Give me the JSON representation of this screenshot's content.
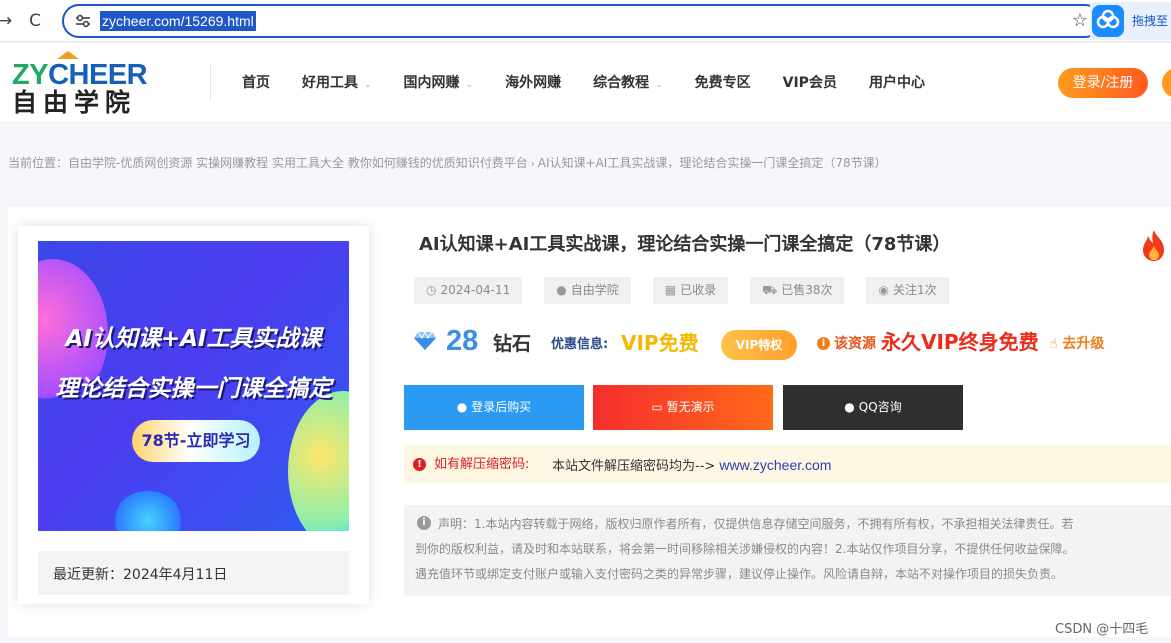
{
  "browser": {
    "back_glyph": "→",
    "reload_glyph": "C",
    "url": "zycheer.com/15269.html",
    "star_glyph": "☆",
    "extension_label": "拖拽至"
  },
  "site": {
    "logo_en_a": "ZY",
    "logo_en_b": "CHEER",
    "logo_cn": "自由学院",
    "nav": [
      {
        "label": "首页",
        "dropdown": false
      },
      {
        "label": "好用工具",
        "dropdown": true
      },
      {
        "label": "国内网赚",
        "dropdown": true
      },
      {
        "label": "海外网赚",
        "dropdown": false
      },
      {
        "label": "综合教程",
        "dropdown": true
      },
      {
        "label": "免费专区",
        "dropdown": false
      },
      {
        "label": "VIP会员",
        "dropdown": false
      },
      {
        "label": "用户中心",
        "dropdown": false
      }
    ],
    "caret_glyph": "⌄",
    "login_label": "登录/注册"
  },
  "breadcrumb": {
    "prefix": "当前位置：",
    "home": "自由学院-优质网创资源 实操网赚教程 实用工具大全 教你如何赚钱的优质知识付费平台",
    "sep": "›",
    "current": "AI认知课+AI工具实战课，理论结合实操一门课全搞定（78节课）"
  },
  "thumbnail": {
    "line1": "AI认知课+AI工具实战课",
    "line2": "理论结合实操一门课全搞定",
    "pill": "78节-立即学习"
  },
  "update": {
    "text": "最近更新：2024年4月11日"
  },
  "post": {
    "title": "AI认知课+AI工具实战课，理论结合实操一门课全搞定（78节课）",
    "meta": [
      {
        "icon": "clock-icon",
        "glyph": "◷",
        "text": "2024-04-11"
      },
      {
        "icon": "user-icon",
        "glyph": "●",
        "text": "自由学院"
      },
      {
        "icon": "windows-icon",
        "glyph": "▦",
        "text": "已收录"
      },
      {
        "icon": "cart-icon",
        "glyph": "⛟",
        "text": "已售38次"
      },
      {
        "icon": "eye-icon",
        "glyph": "◉",
        "text": "关注1次"
      }
    ]
  },
  "price": {
    "amount": "28",
    "unit": "钻石",
    "discount_label": "优惠信息:",
    "discount_value": "VIP免费",
    "vip_badge": "VIP特权",
    "resource_label": "该资源",
    "resource_value": "永久VIP终身免费",
    "upgrade_glyph": "☝",
    "upgrade_label": "去升级",
    "info_glyph": "i"
  },
  "buttons": {
    "buy_glyph": "●",
    "buy": "登录后购买",
    "demo_glyph": "▭",
    "demo": "暂无演示",
    "qq_glyph": "●",
    "qq": "QQ咨询"
  },
  "password": {
    "alert_glyph": "!",
    "label": "如有解压缩密码:",
    "text": "本站文件解压缩密码均为-->",
    "link": "www.zycheer.com"
  },
  "notice": {
    "icon_glyph": "i",
    "line1": "声明：1.本站内容转载于网络，版权归原作者所有，仅提供信息存储空间服务，不拥有所有权，不承担相关法律责任。若",
    "line2": "到你的版权利益，请及时和本站联系，将会第一时间移除相关涉嫌侵权的内容！2.本站仅作项目分享，不提供任何收益保障。",
    "line3": "遇充值环节或绑定支付账户或输入支付密码之类的异常步骤，建议停止操作。风险请自辩，本站不对操作项目的损失负责。"
  },
  "watermark": "CSDN @十四毛",
  "colors": {
    "brand_green": "#21a866",
    "brand_blue": "#1760b8",
    "accent_orange": "#ff7a1f",
    "price_blue": "#3a8ee6",
    "vip_gold": "#f5b800",
    "alert_red": "#ee2a1b"
  }
}
